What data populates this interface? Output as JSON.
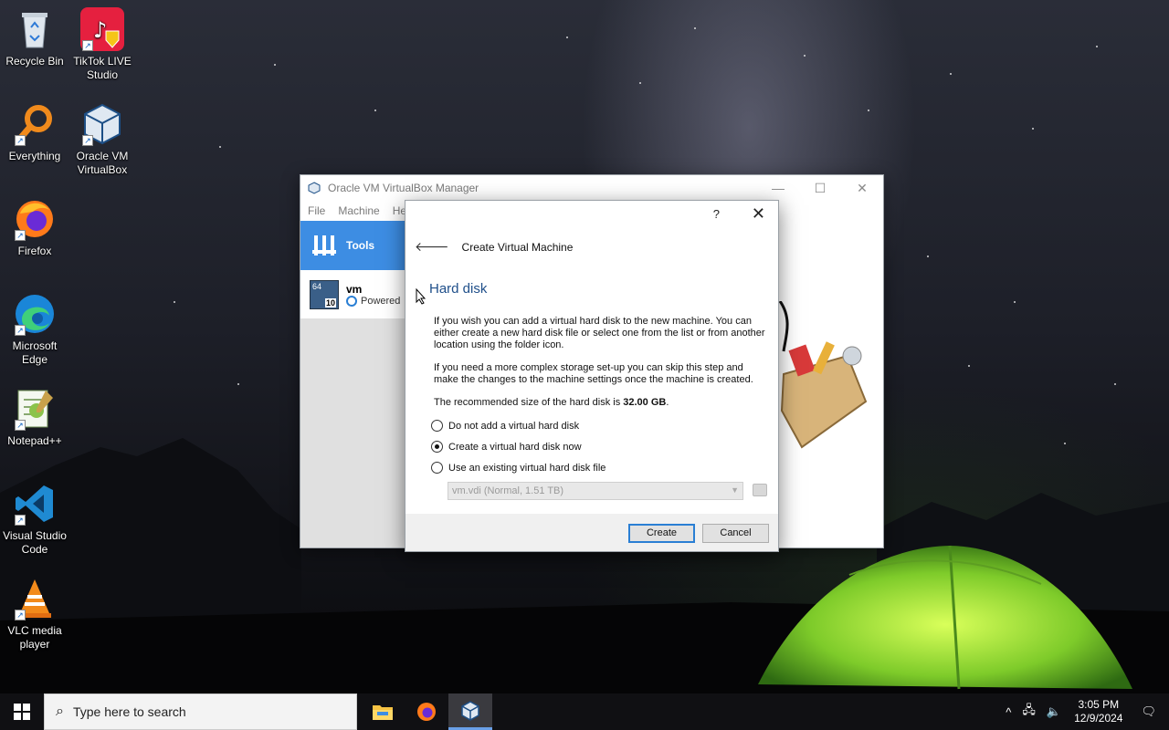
{
  "desktop": {
    "icons": [
      {
        "label": "Recycle Bin",
        "icon": "recycle-bin-icon"
      },
      {
        "label": "TikTok LIVE Studio",
        "icon": "tiktok-icon"
      },
      {
        "label": "Everything",
        "icon": "everything-search-icon"
      },
      {
        "label": "Oracle VM VirtualBox",
        "icon": "virtualbox-icon"
      },
      {
        "label": "Firefox",
        "icon": "firefox-icon"
      },
      {
        "label": "Microsoft Edge",
        "icon": "edge-icon"
      },
      {
        "label": "Notepad++",
        "icon": "notepadpp-icon"
      },
      {
        "label": "Visual Studio Code",
        "icon": "vscode-icon"
      },
      {
        "label": "VLC media player",
        "icon": "vlc-icon"
      }
    ]
  },
  "vbox_manager": {
    "title": "Oracle VM VirtualBox Manager",
    "menu": [
      "File",
      "Machine",
      "He"
    ],
    "tools_label": "Tools",
    "vm": {
      "name": "vm",
      "state": "Powered",
      "badge_top": "64",
      "badge_num": "10"
    }
  },
  "dialog": {
    "help": "?",
    "close": "✕",
    "header": "Create Virtual Machine",
    "section_title": "Hard disk",
    "para1": "If you wish you can add a virtual hard disk to the new machine. You can either create a new hard disk file or select one from the list or from another location using the folder icon.",
    "para2": "If you need a more complex storage set-up you can skip this step and make the changes to the machine settings once the machine is created.",
    "recommended_prefix": "The recommended size of the hard disk is ",
    "recommended_size": "32.00 GB",
    "recommended_suffix": ".",
    "options": [
      {
        "label": "Do not add a virtual hard disk",
        "selected": false
      },
      {
        "label": "Create a virtual hard disk now",
        "selected": true
      },
      {
        "label": "Use an existing virtual hard disk file",
        "selected": false
      }
    ],
    "existing_disk": "vm.vdi (Normal, 1.51 TB)",
    "create_label": "Create",
    "cancel_label": "Cancel"
  },
  "taskbar": {
    "search_placeholder": "Type here to search",
    "apps": [
      "file-explorer-icon",
      "firefox-icon",
      "virtualbox-icon"
    ],
    "time": "3:05 PM",
    "date": "12/9/2024"
  },
  "colors": {
    "accent": "#3d8de3",
    "section_title": "#1f4f8a"
  }
}
